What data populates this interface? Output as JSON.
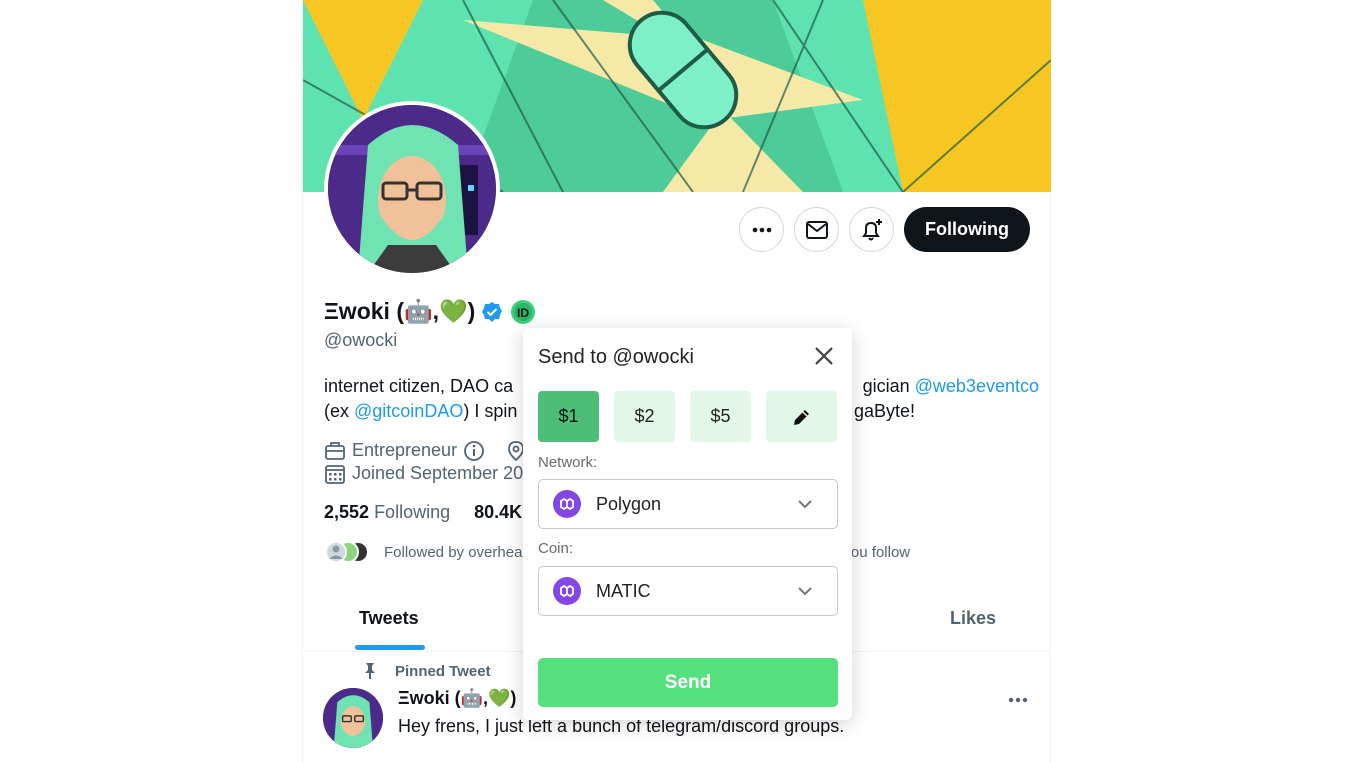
{
  "profile": {
    "name": "Ξwoki (🤖,💚)",
    "handle": "@owocki",
    "follow_label": "Following",
    "bio": {
      "part1": "internet citizen, DAO ca",
      "part2": "gician ",
      "link1": "@web3eventco",
      "line2_prefix": "(ex ",
      "link2": "@gitcoinDAO",
      "line2_mid": ") I spin",
      "line2_end": "gaByte!"
    },
    "meta": {
      "category": "Entrepreneur",
      "joined": "Joined September 20"
    },
    "stats": {
      "following_count": "2,552",
      "following_label": "Following",
      "followers_count": "80.4K"
    },
    "followed_by": {
      "prefix": "Followed by overhea",
      "suffix": "you follow"
    }
  },
  "tabs": {
    "tweets": "Tweets",
    "likes": "Likes"
  },
  "tweet": {
    "pinned_label": "Pinned Tweet",
    "author": "Ξwoki (🤖,💚)",
    "text": "Hey frens, I just left a bunch of telegram/discord groups."
  },
  "modal": {
    "title": "Send to @owocki",
    "amounts": [
      "$1",
      "$2",
      "$5"
    ],
    "selected_amount": "$1",
    "network_label": "Network:",
    "network_value": "Polygon",
    "coin_label": "Coin:",
    "coin_value": "MATIC",
    "send_label": "Send"
  },
  "colors": {
    "banner": "#5ee2b0",
    "accent_blue": "#1d9bf0",
    "selected_amount": "#4ebd77",
    "amount_bg": "#e3f7e9",
    "send_button": "#55e07e",
    "polygon": "#8247e5"
  },
  "icons": {
    "more": "more-horizontal-icon",
    "message": "envelope-icon",
    "notify": "bell-plus-icon",
    "verified": "verified-badge-icon",
    "id": "id-badge-icon",
    "close": "close-icon",
    "edit": "pencil-icon",
    "polygon": "polygon-logo-icon",
    "chevron": "chevron-down-icon",
    "pin": "pin-icon"
  }
}
